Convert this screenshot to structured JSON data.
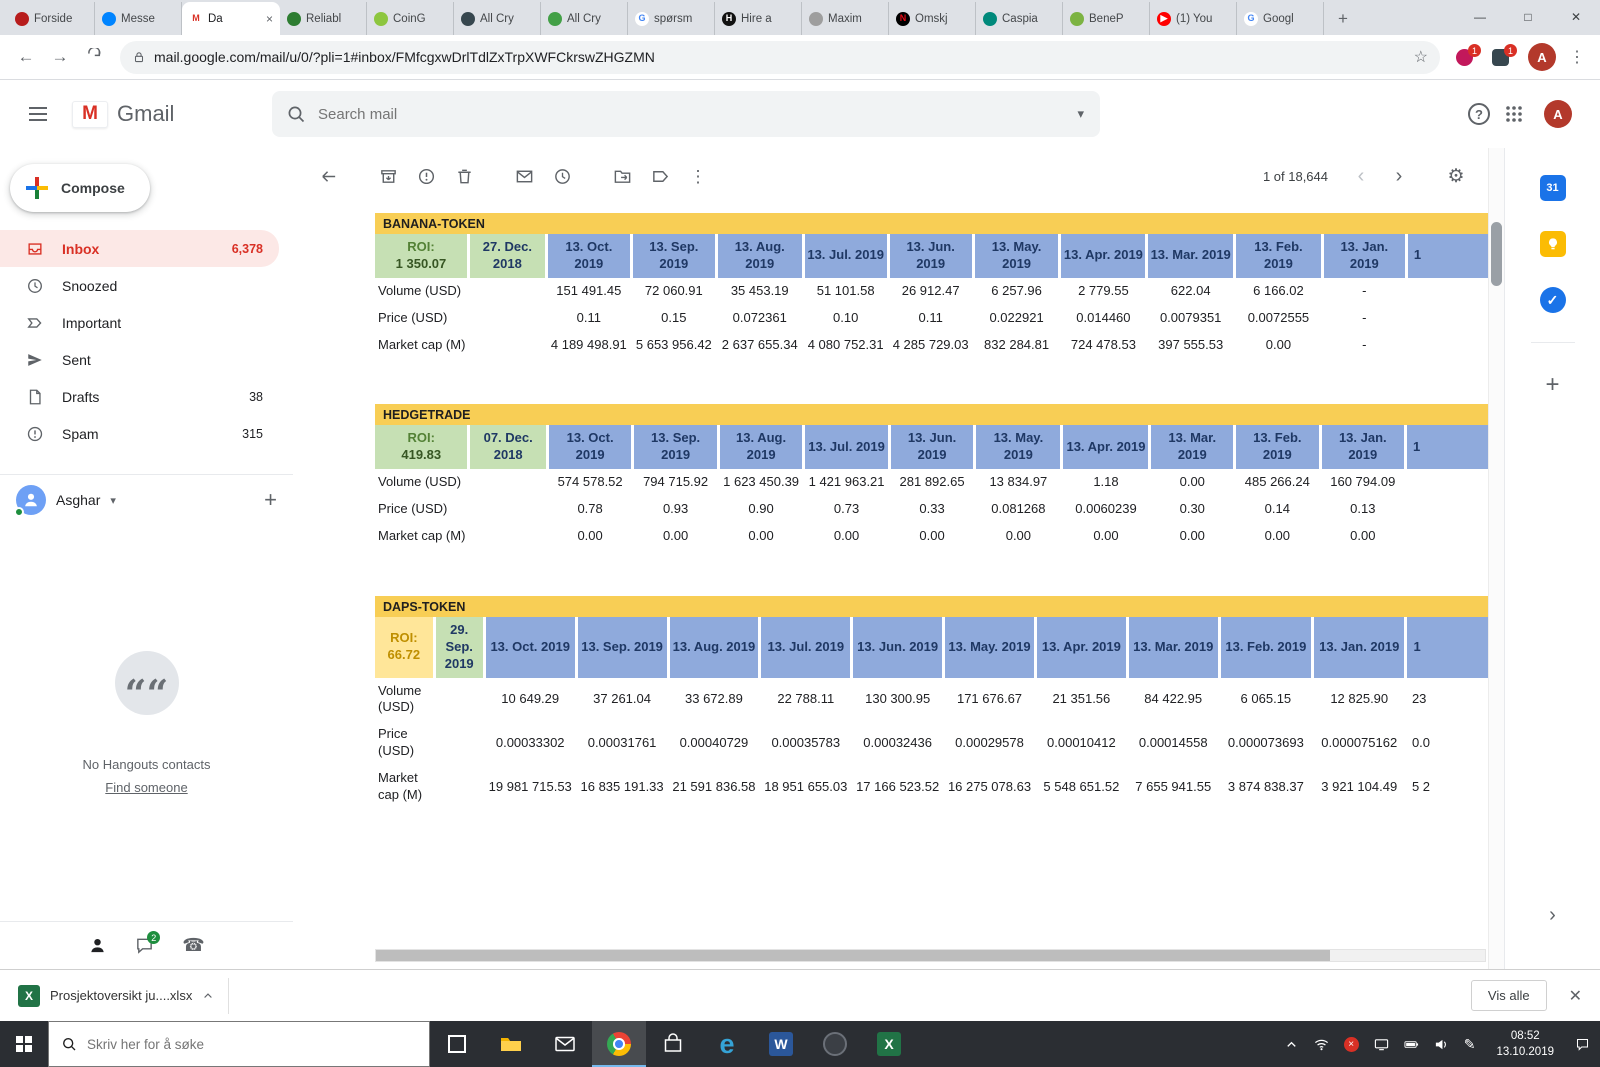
{
  "colors": {
    "banner_yellow": "#F8CE55",
    "header_blue": "#8FAADC",
    "header_blue_text": "#1F3864",
    "cell_green": "#C6E0B4",
    "green_text": "#538135",
    "green_value_text": "#375623",
    "roi_yellow_bg": "#FFE699",
    "roi_yellow_text": "#BF8F00",
    "gmail_red": "#D93025",
    "inbox_pill_bg": "#FCE8E6"
  },
  "glyphs": {
    "back": "←",
    "forward": "→",
    "minimize": "—",
    "maximize": "□",
    "close": "×",
    "more": "⋮",
    "star": "☆",
    "prev": "‹",
    "next": "›",
    "gear": "⚙",
    "caret_down": "▾",
    "plus": "+",
    "help": "?",
    "new_tab": "+",
    "pen": "✎",
    "chevron_right": "›",
    "check": "✓",
    "quote": "““",
    "close_x": "✕"
  },
  "browser": {
    "tabs": [
      {
        "title": "Forside",
        "color": "#b71c1c"
      },
      {
        "title": "Messe",
        "color": "#0084ff"
      },
      {
        "title": "Da",
        "color": "#ffffff",
        "fg": "#d93025",
        "letter": "M",
        "active": true
      },
      {
        "title": "Reliabl",
        "color": "#2e7d32"
      },
      {
        "title": "CoinG",
        "color": "#8dc63f"
      },
      {
        "title": "All Cry",
        "color": "#37474f"
      },
      {
        "title": "All Cry",
        "color": "#43a047"
      },
      {
        "title": "spørsm",
        "color": "#ffffff",
        "fg": "#4285f4",
        "letter": "G"
      },
      {
        "title": "Hire a",
        "color": "#111111",
        "letter": "H"
      },
      {
        "title": "Maxim",
        "color": "#9e9e9e"
      },
      {
        "title": "Omskj",
        "color": "#000000",
        "fg": "#e50914",
        "letter": "N"
      },
      {
        "title": "Caspia",
        "color": "#00897b"
      },
      {
        "title": "BeneP",
        "color": "#7cb342"
      },
      {
        "title": "(1) You",
        "color": "#ff0000",
        "letter": "▶"
      },
      {
        "title": "Googl",
        "color": "#ffffff",
        "fg": "#4285f4",
        "letter": "G"
      }
    ],
    "url": "mail.google.com/mail/u/0/?pli=1#inbox/FMfcgxwDrlTdlZxTrpXWFCkrswZHGZMN",
    "extensions": [
      {
        "badge": "1"
      },
      {
        "badge": "1"
      }
    ],
    "avatar_letter": "A"
  },
  "gmail": {
    "logo_letter": "M",
    "logo_text": "Gmail",
    "search_placeholder": "Search mail",
    "avatar_letter": "A",
    "pagination": "1 of 18,644"
  },
  "sidebar": {
    "compose_label": "Compose",
    "items": [
      {
        "label": "Inbox",
        "count": "6,378",
        "icon": "inbox",
        "active": true
      },
      {
        "label": "Snoozed",
        "count": "",
        "icon": "clock",
        "active": false
      },
      {
        "label": "Important",
        "count": "",
        "icon": "important",
        "active": false
      },
      {
        "label": "Sent",
        "count": "",
        "icon": "send",
        "active": false
      },
      {
        "label": "Drafts",
        "count": "38",
        "icon": "draft",
        "active": false
      },
      {
        "label": "Spam",
        "count": "315",
        "icon": "spam",
        "active": false
      }
    ],
    "profile_name": "Asghar",
    "hangouts_empty": "No Hangouts contacts",
    "hangouts_link": "Find someone",
    "chat_badge": "2"
  },
  "side_panel": {
    "calendar_label": "31"
  },
  "tables": [
    {
      "name": "BANANA-TOKEN",
      "roi_label": "ROI:",
      "roi_value": "1 350.07",
      "roi_style": "green",
      "start_date": "27. Dec. 2018",
      "columns": [
        "13. Oct. 2019",
        "13. Sep. 2019",
        "13. Aug. 2019",
        "13. Jul. 2019",
        "13. Jun. 2019",
        "13. May. 2019",
        "13. Apr. 2019",
        "13. Mar. 2019",
        "13. Feb. 2019",
        "13. Jan. 2019"
      ],
      "partial_column": "1",
      "rows": [
        {
          "label": "Volume (USD)",
          "values": [
            "151 491.45",
            "72 060.91",
            "35 453.19",
            "51 101.58",
            "26 912.47",
            "6 257.96",
            "2 779.55",
            "622.04",
            "6 166.02",
            "-"
          ],
          "partial": ""
        },
        {
          "label": "Price (USD)",
          "values": [
            "0.11",
            "0.15",
            "0.072361",
            "0.10",
            "0.11",
            "0.022921",
            "0.014460",
            "0.0079351",
            "0.0072555",
            "-"
          ],
          "partial": ""
        },
        {
          "label": "Market cap (M)",
          "values": [
            "4 189 498.91",
            "5 653 956.42",
            "2 637 655.34",
            "4 080 752.31",
            "4 285 729.03",
            "832 284.81",
            "724 478.53",
            "397 555.53",
            "0.00",
            "-"
          ],
          "partial": ""
        }
      ]
    },
    {
      "name": "HEDGETRADE",
      "roi_label": "ROI:",
      "roi_value": "419.83",
      "roi_style": "green",
      "start_date": "07. Dec. 2018",
      "columns": [
        "13. Oct. 2019",
        "13. Sep. 2019",
        "13. Aug. 2019",
        "13. Jul. 2019",
        "13. Jun. 2019",
        "13. May. 2019",
        "13. Apr. 2019",
        "13. Mar. 2019",
        "13. Feb. 2019",
        "13. Jan. 2019"
      ],
      "partial_column": "1",
      "rows": [
        {
          "label": "Volume (USD)",
          "values": [
            "574 578.52",
            "794 715.92",
            "1 623 450.39",
            "1 421 963.21",
            "281 892.65",
            "13 834.97",
            "1.18",
            "0.00",
            "485 266.24",
            "160 794.09"
          ],
          "partial": ""
        },
        {
          "label": "Price (USD)",
          "values": [
            "0.78",
            "0.93",
            "0.90",
            "0.73",
            "0.33",
            "0.081268",
            "0.0060239",
            "0.30",
            "0.14",
            "0.13"
          ],
          "partial": ""
        },
        {
          "label": "Market cap (M)",
          "values": [
            "0.00",
            "0.00",
            "0.00",
            "0.00",
            "0.00",
            "0.00",
            "0.00",
            "0.00",
            "0.00",
            "0.00"
          ],
          "partial": ""
        }
      ]
    },
    {
      "name": "DAPS-TOKEN",
      "roi_label": "ROI:",
      "roi_value": "66.72",
      "roi_style": "yellow",
      "start_date": "29. Sep. 2019",
      "columns": [
        "13. Oct. 2019",
        "13. Sep. 2019",
        "13. Aug. 2019",
        "13. Jul. 2019",
        "13. Jun. 2019",
        "13. May. 2019",
        "13. Apr. 2019",
        "13. Mar. 2019",
        "13. Feb. 2019",
        "13. Jan. 2019"
      ],
      "partial_column": "1",
      "rows": [
        {
          "label": "Volume (USD)",
          "values": [
            "10 649.29",
            "37 261.04",
            "33 672.89",
            "22 788.11",
            "130 300.95",
            "171 676.67",
            "21 351.56",
            "84 422.95",
            "6 065.15",
            "12 825.90"
          ],
          "partial": "23"
        },
        {
          "label": "Price (USD)",
          "values": [
            "0.00033302",
            "0.00031761",
            "0.00040729",
            "0.00035783",
            "0.00032436",
            "0.00029578",
            "0.00010412",
            "0.00014558",
            "0.000073693",
            "0.000075162"
          ],
          "partial": "0.0"
        },
        {
          "label": "Market cap (M)",
          "values": [
            "19 981 715.53",
            "16 835 191.33",
            "21 591 836.58",
            "18 951 655.03",
            "17 166 523.52",
            "16 275 078.63",
            "5 548 651.52",
            "7 655 941.55",
            "3 874 838.37",
            "3 921 104.49"
          ],
          "partial": "5 2"
        }
      ]
    }
  ],
  "download_bar": {
    "filename": "Prosjektoversikt ju....xlsx",
    "file_icon_letter": "X",
    "show_all_label": "Vis alle"
  },
  "taskbar": {
    "search_placeholder": "Skriv her for å søke",
    "apps": [
      "task-view",
      "file-explorer",
      "mail",
      "chrome",
      "store",
      "edge",
      "word",
      "globe",
      "excel"
    ],
    "active_app": "chrome",
    "tray_icons": [
      "chevron-up",
      "wifi",
      "sync-error",
      "display",
      "battery",
      "volume",
      "pen"
    ],
    "clock_time": "08:52",
    "clock_date": "13.10.2019"
  }
}
